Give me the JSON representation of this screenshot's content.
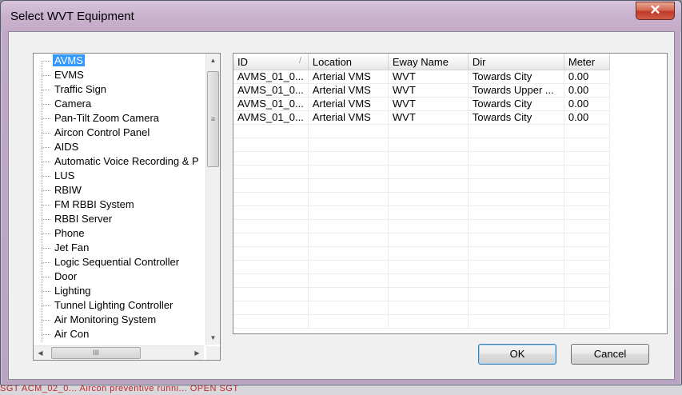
{
  "window": {
    "title": "Select WVT Equipment",
    "close_symbol": "✕"
  },
  "background_strip": "SGT  ACM_02_0...   Aircon preventive runni...   OPEN     SGT",
  "tree": {
    "selected_index": 0,
    "items": [
      "AVMS",
      "EVMS",
      "Traffic Sign",
      "Camera",
      "Pan-Tilt Zoom Camera",
      "Aircon Control Panel",
      "AIDS",
      "Automatic Voice Recording & P",
      "LUS",
      "RBIW",
      "FM RBBI System",
      "RBBI Server",
      "Phone",
      "Jet Fan",
      "Logic Sequential Controller",
      "Door",
      "Lighting",
      "Tunnel Lighting Controller",
      "Air Monitoring System",
      "Air Con"
    ]
  },
  "grid": {
    "columns": [
      {
        "label": "ID",
        "sort_mark": "/"
      },
      {
        "label": "Location"
      },
      {
        "label": "Eway Name"
      },
      {
        "label": "Dir"
      },
      {
        "label": "Meter"
      }
    ],
    "rows": [
      [
        "AVMS_01_0...",
        "Arterial VMS",
        "WVT",
        "Towards City",
        "0.00"
      ],
      [
        "AVMS_01_0...",
        "Arterial VMS",
        "WVT",
        "Towards Upper ...",
        "0.00"
      ],
      [
        "AVMS_01_0...",
        "Arterial VMS",
        "WVT",
        "Towards City",
        "0.00"
      ],
      [
        "AVMS_01_0...",
        "Arterial VMS",
        "WVT",
        "Towards City",
        "0.00"
      ]
    ]
  },
  "buttons": {
    "ok": "OK",
    "cancel": "Cancel"
  },
  "colors": {
    "selection": "#3399ff",
    "title_bar": "#c4abc9",
    "close_button": "#c0392b"
  }
}
